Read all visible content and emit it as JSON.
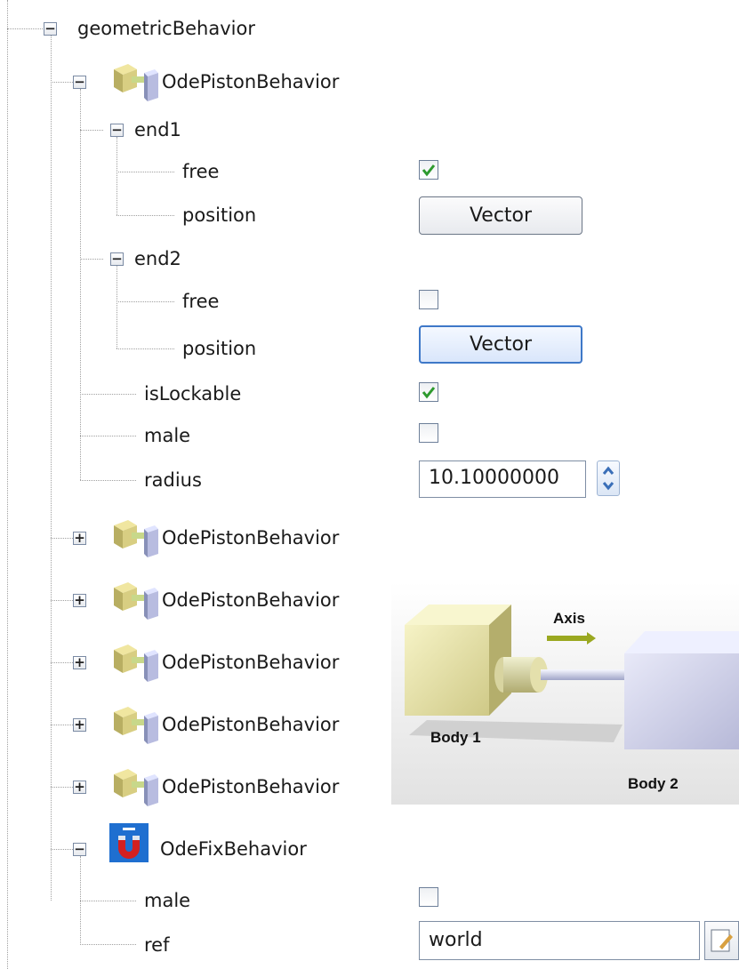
{
  "tree": {
    "root_label": "geometricBehavior",
    "piston1_label": "OdePistonBehavior",
    "end1_label": "end1",
    "end1_free_label": "free",
    "end1_position_label": "position",
    "end1_position_button": "Vector",
    "end1_free_checked": true,
    "end2_label": "end2",
    "end2_free_label": "free",
    "end2_position_label": "position",
    "end2_position_button": "Vector",
    "end2_free_checked": false,
    "islockable_label": "isLockable",
    "islockable_checked": true,
    "male_label": "male",
    "male_checked": false,
    "radius_label": "radius",
    "radius_value": "10.10000000",
    "collapsed_pistons": [
      "OdePistonBehavior",
      "OdePistonBehavior",
      "OdePistonBehavior",
      "OdePistonBehavior",
      "OdePistonBehavior"
    ],
    "fix_label": "OdeFixBehavior",
    "fix_male_label": "male",
    "fix_male_checked": false,
    "fix_ref_label": "ref",
    "fix_ref_value": "world"
  },
  "diagram": {
    "axis_label": "Axis",
    "body1_label": "Body 1",
    "body2_label": "Body 2"
  },
  "colors": {
    "check": "#2e9a2e",
    "focus_border": "#3e78c8",
    "body1": "#e8e4a8",
    "body2": "#d2d4ec",
    "axis_arrow": "#9aa820"
  }
}
